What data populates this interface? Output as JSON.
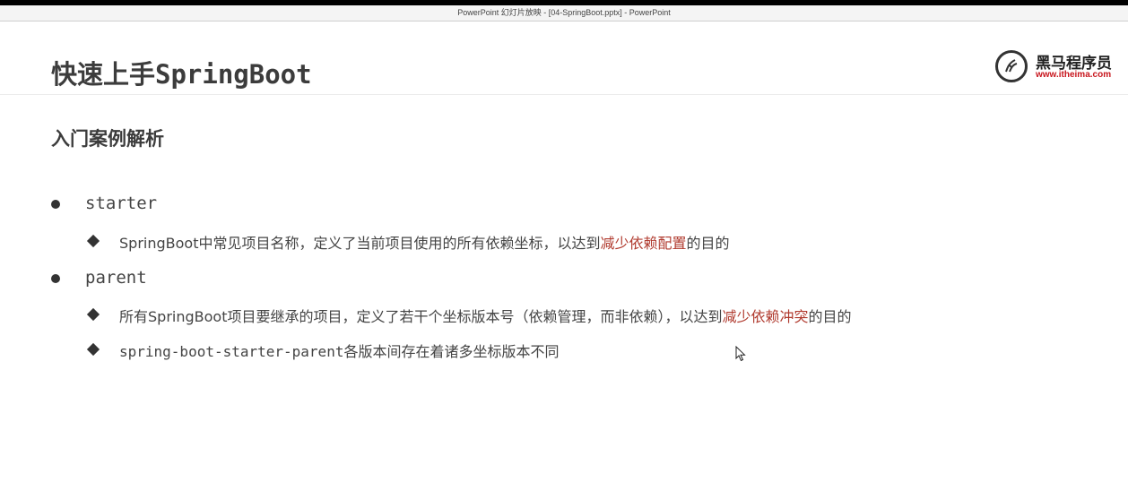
{
  "window": {
    "title": "PowerPoint 幻灯片放映 - [04-SpringBoot.pptx] - PowerPoint"
  },
  "slide": {
    "title": "快速上手SpringBoot",
    "logo": {
      "name": "黑马程序员",
      "url": "www.itheima.com"
    },
    "subtitle": "入门案例解析",
    "items": [
      {
        "label": "starter",
        "subitems": [
          {
            "pre": "SpringBoot中常见项目名称，定义了当前项目使用的所有依赖坐标，以达到",
            "highlight": "减少依赖配置",
            "post": "的目的"
          }
        ]
      },
      {
        "label": "parent",
        "subitems": [
          {
            "pre": "所有SpringBoot项目要继承的项目，定义了若干个坐标版本号（依赖管理，而非依赖），以达到",
            "highlight": "减少依赖冲突",
            "post": "的目的"
          },
          {
            "mono": "spring-boot-starter-parent",
            "text": "各版本间存在着诸多坐标版本不同"
          }
        ]
      }
    ]
  },
  "colors": {
    "highlight": "#b03a2e",
    "text": "#444444",
    "logo_url": "#c8161d"
  }
}
